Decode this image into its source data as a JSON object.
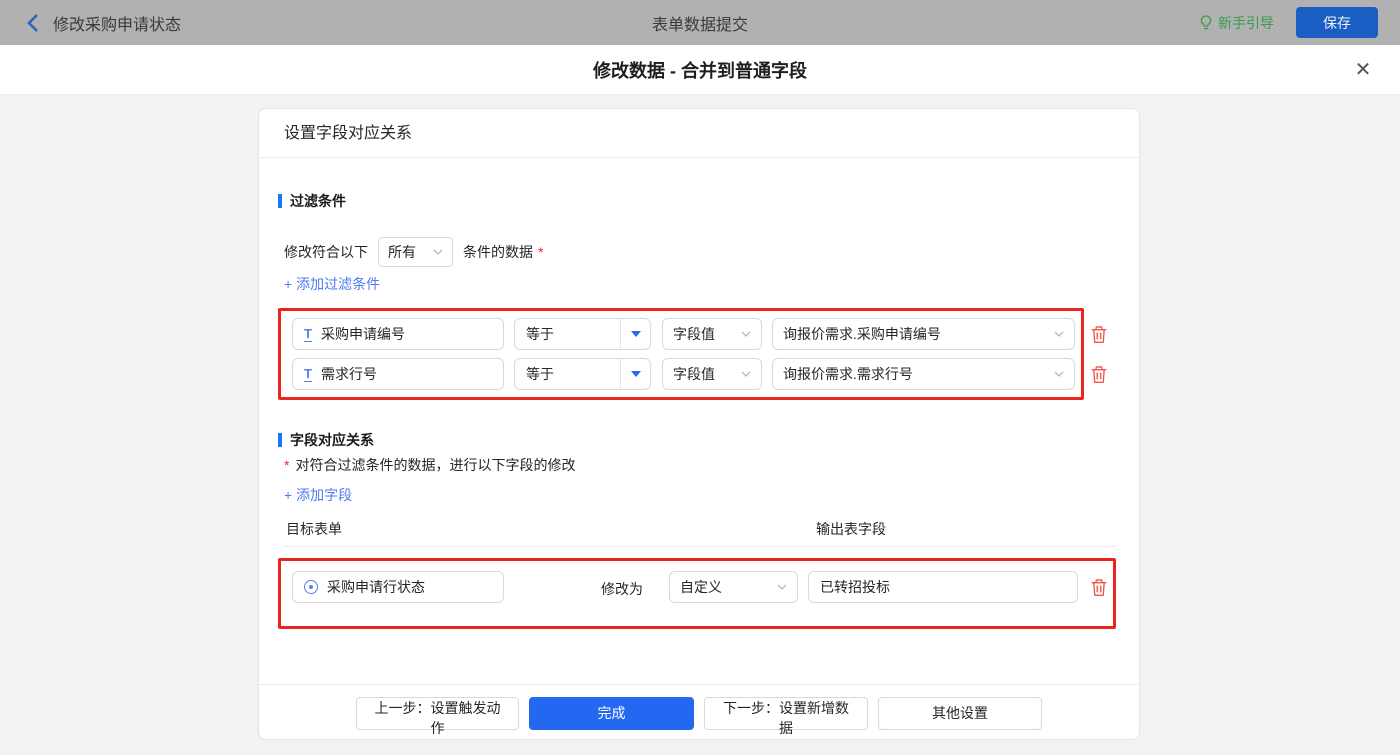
{
  "topbar": {
    "back_title": "修改采购申请状态",
    "center_title": "表单数据提交",
    "guide_label": "新手引导",
    "save_label": "保存"
  },
  "modal": {
    "title": "修改数据 - 合并到普通字段",
    "close_icon": "✕"
  },
  "card": {
    "header": "设置字段对应关系"
  },
  "filter": {
    "title": "过滤条件",
    "prefix": "修改符合以下",
    "match_value": "所有",
    "suffix": "条件的数据",
    "required_mark": "*",
    "add_link": "+ 添加过滤条件",
    "rows": [
      {
        "field": "采购申请编号",
        "operator": "等于",
        "value_type": "字段值",
        "value": "询报价需求.采购申请编号"
      },
      {
        "field": "需求行号",
        "operator": "等于",
        "value_type": "字段值",
        "value": "询报价需求.需求行号"
      }
    ]
  },
  "mapping": {
    "title": "字段对应关系",
    "required_mark": "*",
    "desc": "对符合过滤条件的数据，进行以下字段的修改",
    "add_link": "+ 添加字段",
    "col_target": "目标表单",
    "col_output": "输出表字段",
    "rows": [
      {
        "field": "采购申请行状态",
        "action": "修改为",
        "mode": "自定义",
        "value": "已转招投标"
      }
    ]
  },
  "footer": {
    "prev": "上一步：设置触发动作",
    "done": "完成",
    "next": "下一步：设置新增数据",
    "other": "其他设置"
  },
  "accents": {
    "brand_blue": "#2468f2",
    "section_bar_blue": "#1677ff",
    "link_blue": "#4e7cf0",
    "highlight_red": "#e8251f",
    "danger_red": "#f25048",
    "guide_green": "#3a9a4e"
  }
}
